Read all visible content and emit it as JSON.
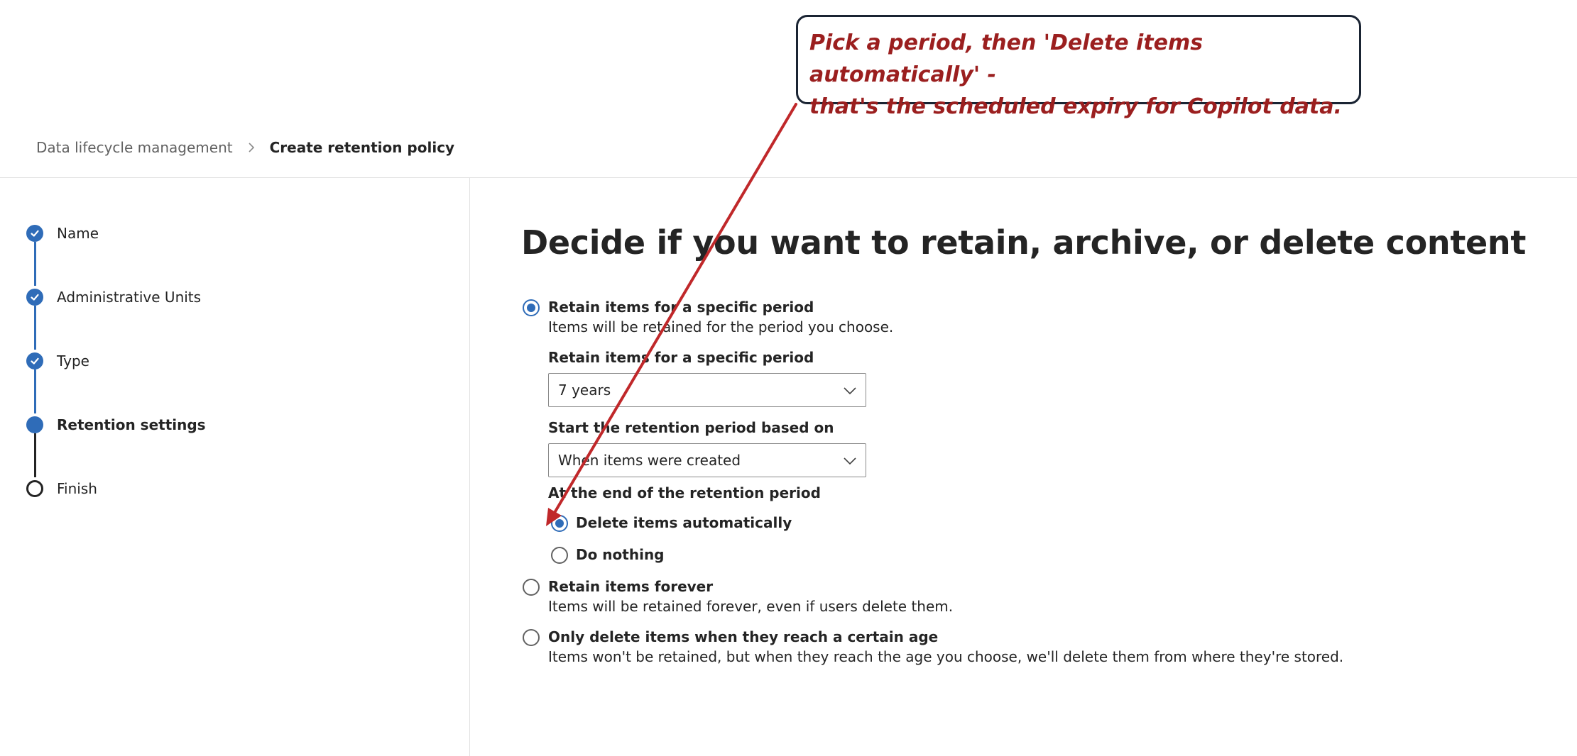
{
  "breadcrumb": {
    "parent": "Data lifecycle management",
    "current": "Create retention policy"
  },
  "steps": [
    {
      "label": "Name",
      "status": "completed"
    },
    {
      "label": "Administrative Units",
      "status": "completed"
    },
    {
      "label": "Type",
      "status": "completed"
    },
    {
      "label": "Retention settings",
      "status": "current"
    },
    {
      "label": "Finish",
      "status": "not-started"
    }
  ],
  "main": {
    "title": "Decide if you want to retain, archive, or delete content",
    "retain_period": {
      "label": "Retain items for a specific period",
      "description": "Items will be retained for the period you choose.",
      "selected": true,
      "period_field": {
        "label": "Retain items for a specific period",
        "value": "7 years"
      },
      "start_field": {
        "label": "Start the retention period based on",
        "value": "When items were created"
      },
      "end_of_period": {
        "label": "At the end of the retention period",
        "delete_automatically": "Delete items automatically",
        "do_nothing": "Do nothing",
        "selected": "delete_automatically"
      }
    },
    "retain_forever": {
      "label": "Retain items forever",
      "description": "Items will be retained forever, even if users delete them.",
      "selected": false
    },
    "delete_only": {
      "label": "Only delete items when they reach a certain age",
      "description": "Items won't be retained, but when they reach the age you choose, we'll delete them from where they're stored.",
      "selected": false
    }
  },
  "annotation": {
    "line1": "Pick a period, then 'Delete items automatically' -",
    "line2": "that's the scheduled expiry for Copilot data."
  },
  "colors": {
    "accent": "#2f6cb8",
    "annotation_text": "#9b1f1f",
    "annotation_arrow": "#c0282a"
  }
}
